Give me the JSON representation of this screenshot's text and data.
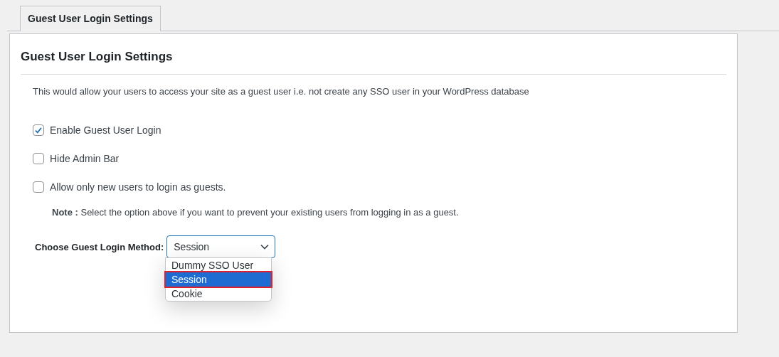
{
  "tabs": [
    {
      "label": "Guest User Login Settings",
      "selected": true
    }
  ],
  "panel": {
    "title": "Guest User Login Settings",
    "description": "This would allow your users to access your site as a guest user i.e. not create any SSO user in your WordPress database",
    "options": [
      {
        "label": "Enable Guest User Login",
        "checked": true
      },
      {
        "label": "Hide Admin Bar",
        "checked": false
      },
      {
        "label": "Allow only new users to login as guests.",
        "checked": false
      }
    ],
    "note": "**Note :** Select the option above if you want to prevent your existing users from logging in as a guest.",
    "method": {
      "label": "Choose Guest Login Method:",
      "value": "Session",
      "expanded": true,
      "choices": [
        {
          "label": "Dummy SSO User",
          "selected": false,
          "highlighted": false
        },
        {
          "label": "Session",
          "selected": true,
          "highlighted": true
        },
        {
          "label": "Cookie",
          "selected": false,
          "highlighted": false
        }
      ]
    }
  }
}
